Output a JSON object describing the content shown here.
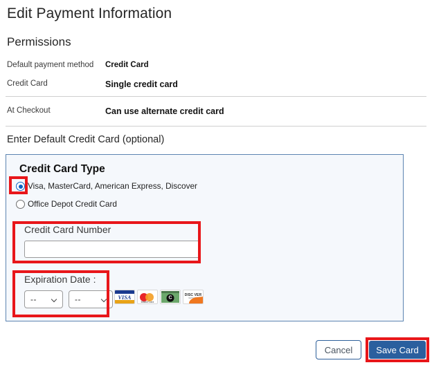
{
  "page": {
    "title": "Edit Payment Information",
    "section_title": "Permissions",
    "subhead": "Enter Default Credit Card (optional)"
  },
  "permissions": {
    "rows": [
      {
        "label": "Default payment method",
        "value": "Credit Card"
      },
      {
        "label": "Credit Card",
        "value": "Single credit card"
      },
      {
        "label": "At Checkout",
        "value": "Can use alternate credit card"
      }
    ]
  },
  "card_panel": {
    "heading": "Credit Card Type",
    "radios": [
      {
        "label": "Visa, MasterCard, American Express, Discover",
        "selected": true
      },
      {
        "label": "Office Depot Credit Card",
        "selected": false
      }
    ],
    "card_number": {
      "label": "Credit Card Number",
      "value": "",
      "placeholder": ""
    },
    "expiration": {
      "label": "Expiration Date :",
      "month_value": "--",
      "year_value": "--"
    },
    "brands": [
      {
        "name": "visa-logo",
        "text": "VISA"
      },
      {
        "name": "mastercard-logo",
        "text": "MasterCard"
      },
      {
        "name": "amex-logo",
        "text": "C"
      },
      {
        "name": "discover-logo",
        "text": "DISC VER",
        "sub": "NETWORK"
      }
    ]
  },
  "footer": {
    "cancel_label": "Cancel",
    "save_label": "Save Card"
  },
  "colors": {
    "panel_bg": "#f5f8fc",
    "panel_border": "#5b84b1",
    "highlight_red": "#e8161a",
    "primary_blue": "#2a5f9e",
    "radio_blue": "#0a62c4"
  }
}
